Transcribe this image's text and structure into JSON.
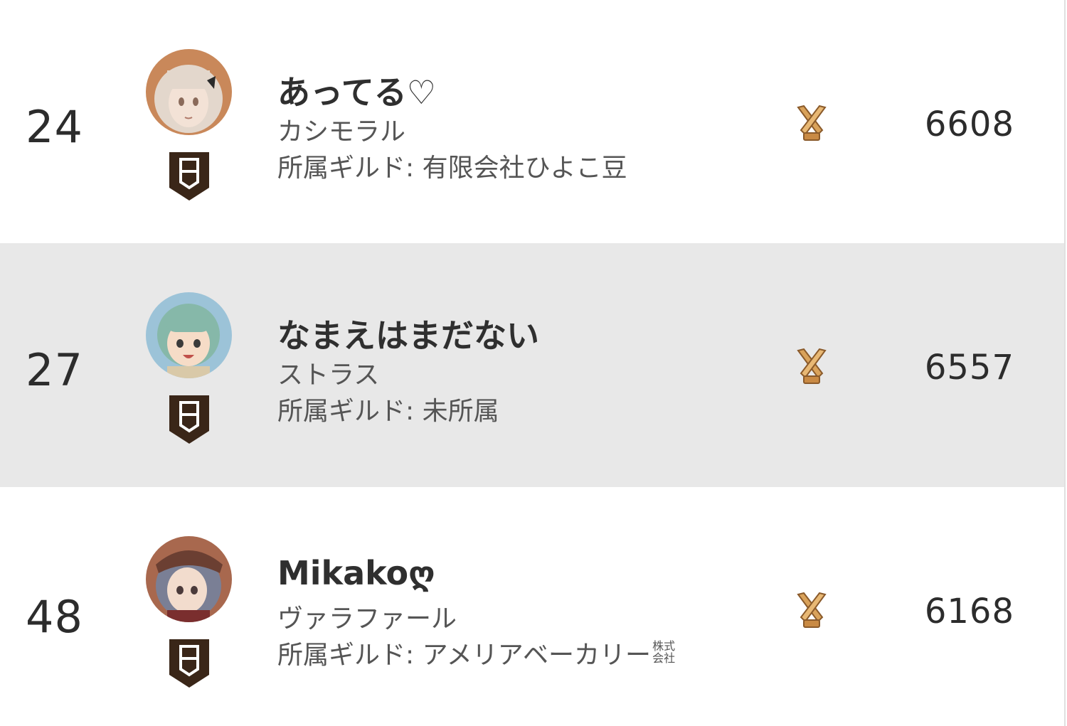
{
  "ranking": {
    "guild_prefix": "所属ギルド: ",
    "entries": [
      {
        "rank": "24",
        "player_name": "あってる♡",
        "character": "カシモラル",
        "guild": "有限会社ひよこ豆",
        "guild_suffix": "",
        "score": "6608",
        "avatar_colors": {
          "bg": "#c9885a",
          "hair": "#e3d7cc",
          "skin": "#f3e2d6"
        }
      },
      {
        "rank": "27",
        "player_name": "なまえはまだない",
        "character": "ストラス",
        "guild": "未所属",
        "guild_suffix": "",
        "score": "6557",
        "avatar_colors": {
          "bg": "#9cc3d8",
          "hair": "#86b8a9",
          "skin": "#f6dcc7"
        }
      },
      {
        "rank": "48",
        "player_name": "Mikakoღ",
        "character": "ヴァラファール",
        "guild": "アメリアベーカリー",
        "guild_suffix": "株式会社",
        "score": "6168",
        "avatar_colors": {
          "bg": "#a8684e",
          "hair": "#7a7f95",
          "skin": "#f2dccd"
        }
      }
    ]
  },
  "colors": {
    "row_highlight": "#e8e8e8",
    "rank_badge": "#3a2618",
    "score_icon_gold": "#d9a25a"
  }
}
